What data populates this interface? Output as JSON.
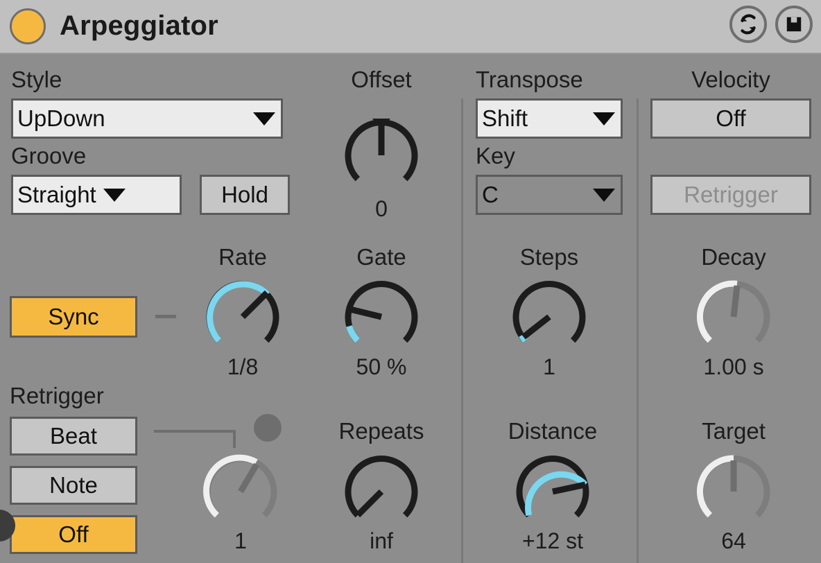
{
  "device": {
    "title": "Arpeggiator",
    "led_color": "#f5b942",
    "titlebar_bg": "#c0c0c0",
    "body_bg": "#8d8d8d",
    "accent_on": "#f5b942",
    "accent_knob": "#7ad7f0",
    "buttons": [
      {
        "name": "swap-preset-button",
        "icon": "swap-arrows-icon"
      },
      {
        "name": "save-preset-button",
        "icon": "floppy-disk-icon"
      }
    ]
  },
  "style_section": {
    "style_label": "Style",
    "style_value": "UpDown",
    "groove_label": "Groove",
    "groove_value": "Straight",
    "hold_label": "Hold"
  },
  "offset": {
    "label": "Offset",
    "value": "0"
  },
  "transpose": {
    "label": "Transpose",
    "value": "Shift",
    "key_label": "Key",
    "key_value": "C"
  },
  "velocity": {
    "label": "Velocity",
    "mode_value": "Off",
    "retrigger_label": "Retrigger"
  },
  "timing": {
    "sync_label": "Sync",
    "rate_label": "Rate",
    "rate_value": "1/8",
    "gate_label": "Gate",
    "gate_value": "50 %"
  },
  "steps": {
    "label": "Steps",
    "value": "1",
    "distance_label": "Distance",
    "distance_value": "+12 st"
  },
  "decay": {
    "label": "Decay",
    "value": "1.00 s",
    "target_label": "Target",
    "target_value": "64"
  },
  "retrigger": {
    "label": "Retrigger",
    "beat_label": "Beat",
    "note_label": "Note",
    "off_label": "Off",
    "interval_value": "1"
  },
  "repeats": {
    "label": "Repeats",
    "value": "inf"
  },
  "chart_data": {
    "type": "knob-positions",
    "knobs": [
      {
        "name": "Offset",
        "display": "0",
        "angle_deg": 0,
        "arc_start_deg": 0,
        "arc_end_deg": 0,
        "enabled": true,
        "arc_color": "#7ad7f0"
      },
      {
        "name": "Rate",
        "display": "1/8",
        "angle_deg": 48,
        "arc_start_deg": -135,
        "arc_end_deg": 48,
        "enabled": true,
        "arc_color": "#7ad7f0"
      },
      {
        "name": "Gate",
        "display": "50 %",
        "angle_deg": -105,
        "arc_start_deg": -135,
        "arc_end_deg": -105,
        "enabled": true,
        "arc_color": "#7ad7f0"
      },
      {
        "name": "Steps",
        "display": "1",
        "angle_deg": -128,
        "arc_start_deg": -135,
        "arc_end_deg": -128,
        "enabled": true,
        "arc_color": "#7ad7f0"
      },
      {
        "name": "Decay",
        "display": "1.00 s",
        "angle_deg": 6,
        "arc_start_deg": -135,
        "arc_end_deg": 6,
        "enabled": false,
        "arc_color": "#efefef"
      },
      {
        "name": "Interval",
        "display": "1",
        "angle_deg": 28,
        "arc_start_deg": -135,
        "arc_end_deg": 28,
        "enabled": false,
        "arc_color": "#efefef"
      },
      {
        "name": "Repeats",
        "display": "inf",
        "angle_deg": -132,
        "arc_start_deg": 0,
        "arc_end_deg": 0,
        "enabled": true,
        "arc_color": "#7ad7f0"
      },
      {
        "name": "Distance",
        "display": "+12 st",
        "angle_deg": 78,
        "arc_start_deg": -135,
        "arc_end_deg": 78,
        "enabled": true,
        "arc_color": "#7ad7f0"
      },
      {
        "name": "Target",
        "display": "64",
        "angle_deg": 0,
        "arc_start_deg": -135,
        "arc_end_deg": 0,
        "enabled": false,
        "arc_color": "#efefef"
      }
    ]
  }
}
